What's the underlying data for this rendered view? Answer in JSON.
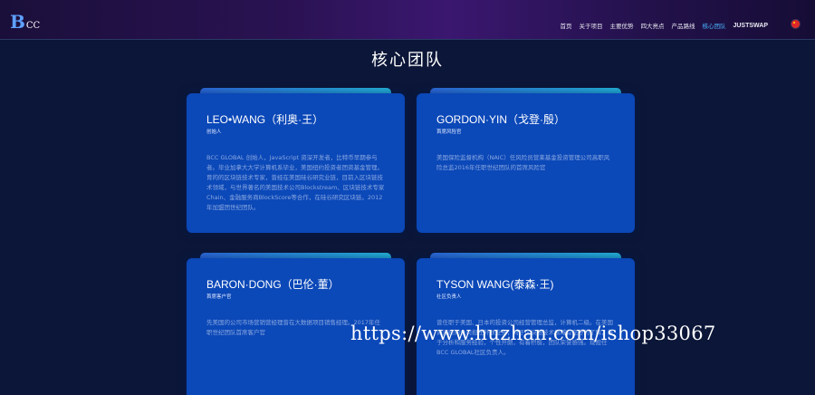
{
  "header": {
    "logo_b": "B",
    "logo_cc": "CC",
    "nav": [
      {
        "label": "首页",
        "active": false
      },
      {
        "label": "关于项目",
        "active": false
      },
      {
        "label": "主要优势",
        "active": false
      },
      {
        "label": "四大亮点",
        "active": false
      },
      {
        "label": "产品路线",
        "active": false
      },
      {
        "label": "核心团队",
        "active": true
      },
      {
        "label": "JUSTSWAP",
        "active": false
      }
    ],
    "language_icon": "china-flag-icon"
  },
  "section": {
    "title": "核心团队"
  },
  "cards": [
    {
      "name": "LEO•WANG（利奥·王）",
      "role": "创始人",
      "desc": "BCC GLOBAL 创始人，JavaScript 资深开发者，比特币早期参与者。毕业加拿大大学计算机系毕业，美国纽约投资者团资基金管理。育的的区块链技术专家，曾经在美国硅谷研究业链，目前入区块链技术领域，与世界著名的美国技术公司Blockstream、区块链技术专家Chain、金融服务商BlockScore等合作，在硅谷研究区块链。2012年加盟团世纪团队。"
    },
    {
      "name": "GORDON·YIN（戈登·殷）",
      "role": "首席风险官",
      "desc": "美国保险监督机构（NAIC）任风险员营莱基金投资管理公司高职风险总监2016年任职世纪团队的首席风险官"
    },
    {
      "name": "BARON·DONG（巴伦·董）",
      "role": "首席客户官",
      "desc": "先美国的公司市场营销营经理曾在大数据项目销售经理。2017年任职世纪团队首席客户官"
    },
    {
      "name": "TYSON WANG(泰森·王)",
      "role": "社区负责人",
      "desc": "曾任职于美国、日本的投资公司经营管理总监，计算机二级。在美国资深顾问公司担任外联业务，对于区块链技术领域有充分的了解，善于分析和服务经验，个性开朗，有着积极，团队荣誉感强。现担任BCC GLOBAL社区负责人。"
    }
  ],
  "watermark": "https://www.huzhan.com/ishop33067"
}
